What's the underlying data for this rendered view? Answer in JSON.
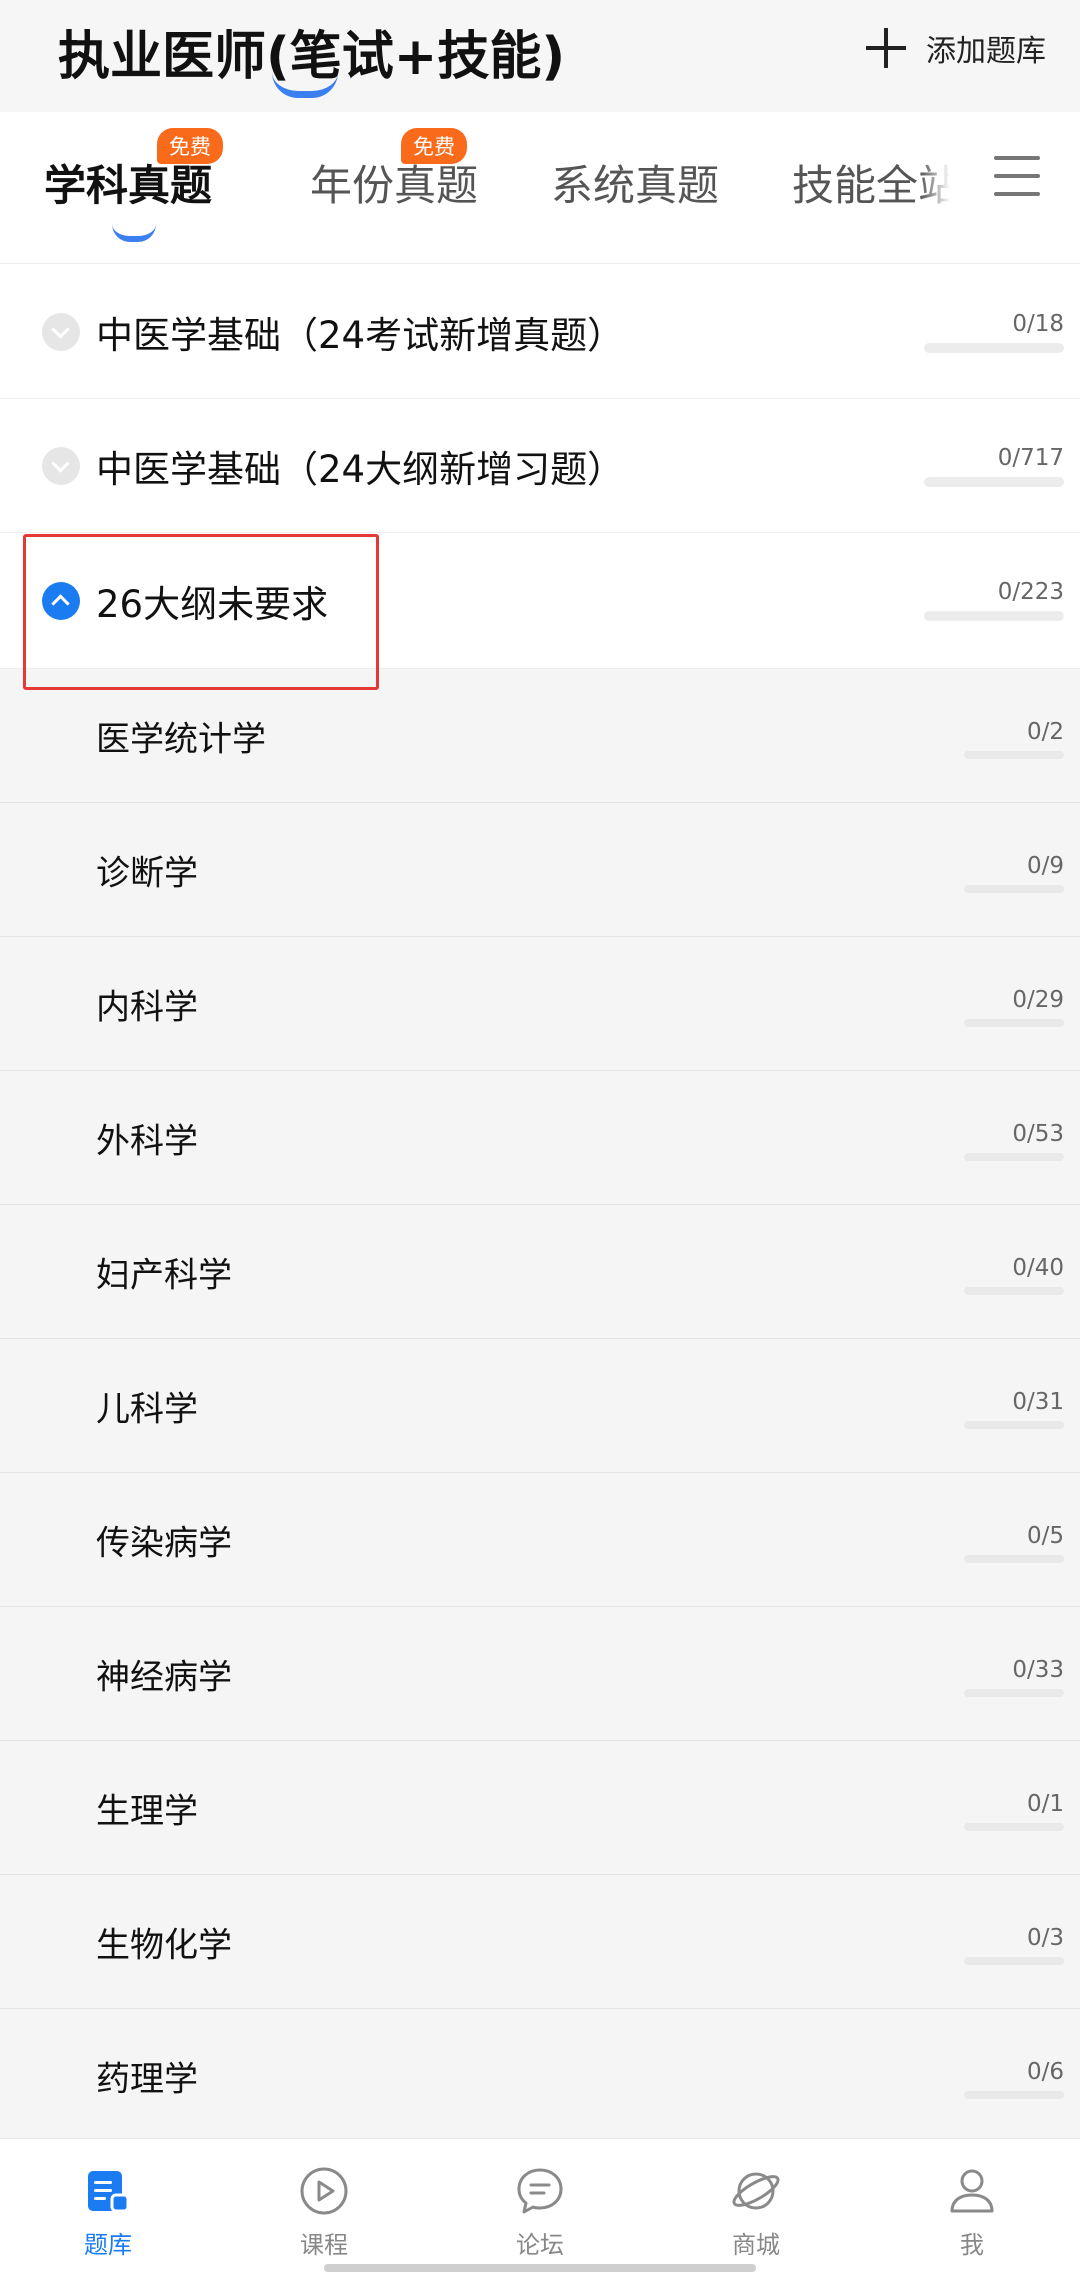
{
  "header": {
    "title": "执业医师(笔试+技能)",
    "add_bank_label": "添加题库"
  },
  "tabs": [
    {
      "label": "学科真题",
      "badge": "免费",
      "active": true
    },
    {
      "label": "年份真题",
      "badge": "免费",
      "active": false
    },
    {
      "label": "系统真题",
      "badge": "",
      "active": false
    },
    {
      "label": "技能全站",
      "badge": "",
      "active": false
    }
  ],
  "categories": [
    {
      "label": "中医学基础（24考试新增真题）",
      "count": "0/18",
      "progress": 0,
      "expanded": false
    },
    {
      "label": "中医学基础（24大纲新增习题）",
      "count": "0/717",
      "progress": 0,
      "expanded": false
    },
    {
      "label": "26大纲未要求",
      "count": "0/223",
      "progress": 0,
      "expanded": true
    }
  ],
  "subjects": [
    {
      "label": "医学统计学",
      "count": "0/2",
      "progress": 0
    },
    {
      "label": "诊断学",
      "count": "0/9",
      "progress": 0
    },
    {
      "label": "内科学",
      "count": "0/29",
      "progress": 0
    },
    {
      "label": "外科学",
      "count": "0/53",
      "progress": 0
    },
    {
      "label": "妇产科学",
      "count": "0/40",
      "progress": 0
    },
    {
      "label": "儿科学",
      "count": "0/31",
      "progress": 0
    },
    {
      "label": "传染病学",
      "count": "0/5",
      "progress": 0
    },
    {
      "label": "神经病学",
      "count": "0/33",
      "progress": 0
    },
    {
      "label": "生理学",
      "count": "0/1",
      "progress": 0
    },
    {
      "label": "生物化学",
      "count": "0/3",
      "progress": 0
    },
    {
      "label": "药理学",
      "count": "0/6",
      "progress": 0
    }
  ],
  "bottom_nav": [
    {
      "label": "题库",
      "icon": "question-bank-icon",
      "active": true
    },
    {
      "label": "课程",
      "icon": "play-circle-icon",
      "active": false
    },
    {
      "label": "论坛",
      "icon": "chat-bubble-icon",
      "active": false
    },
    {
      "label": "商城",
      "icon": "planet-icon",
      "active": false
    },
    {
      "label": "我",
      "icon": "person-icon",
      "active": false
    }
  ],
  "colors": {
    "accent": "#1b7cf2",
    "badge": "#f96a1b",
    "highlight_box": "#e53935"
  }
}
